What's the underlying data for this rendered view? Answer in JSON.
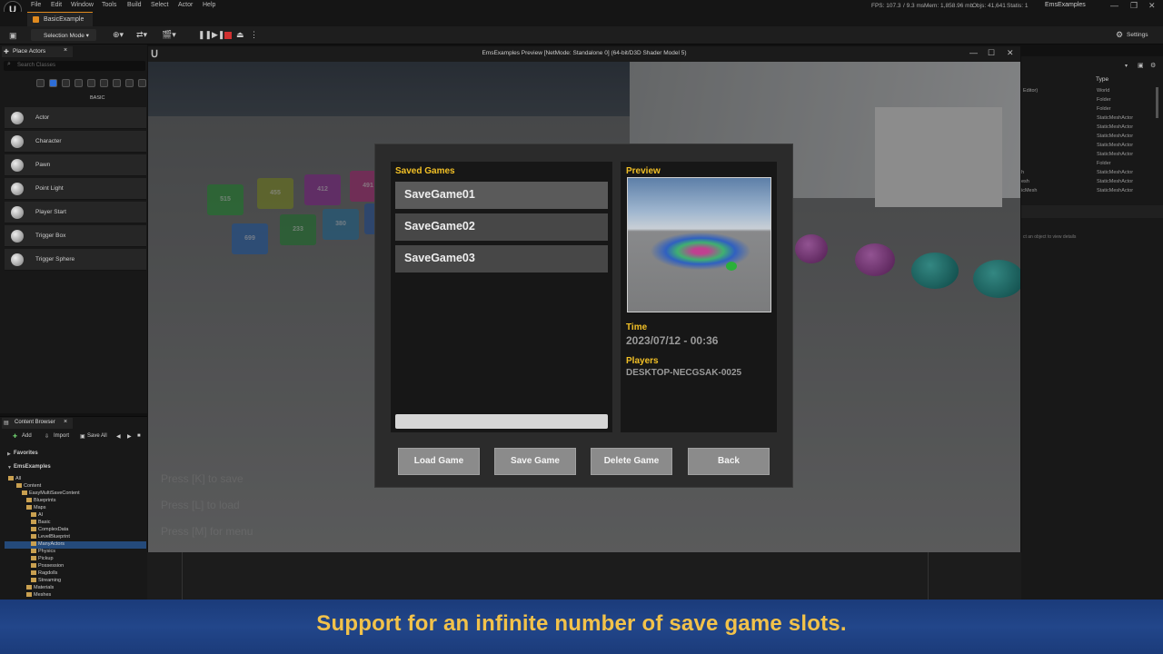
{
  "app": {
    "menu": [
      "File",
      "Edit",
      "Window",
      "Tools",
      "Build",
      "Select",
      "Actor",
      "Help"
    ],
    "level_tab": "BasicExample",
    "stats": {
      "fps": "FPS: 107.3",
      "ms": "/ 9.3 ms",
      "mem": "Mem: 1,858.96 mb",
      "objs": "Objs: 41,641",
      "statics": "Statis: 1"
    },
    "window_name": "EmsExamples"
  },
  "toolbar": {
    "selection_mode": "Selection Mode",
    "settings": "Settings"
  },
  "place_actors": {
    "tab": "Place Actors",
    "search_placeholder": "Search Classes",
    "category": "BASIC",
    "actors": [
      "Actor",
      "Character",
      "Pawn",
      "Point Light",
      "Player Start",
      "Trigger Box",
      "Trigger Sphere"
    ]
  },
  "content_browser": {
    "tab": "Content Browser",
    "add": "Add",
    "import": "Import",
    "save_all": "Save All",
    "favorites": "Favorites",
    "project": "EmsExamples",
    "tree": [
      "All",
      "Content",
      "EasyMultiSaveContent",
      "Blueprints",
      "Maps",
      "AI",
      "Basic",
      "ComplexData",
      "LevelBlueprint",
      "ManyActors",
      "Physics",
      "Pickup",
      "Possession",
      "Ragdolls",
      "Streaming",
      "Materials",
      "Meshes"
    ]
  },
  "outliner": {
    "type_header": "Type",
    "editor_suffix": "Editor)",
    "rows": [
      [
        "",
        "World"
      ],
      [
        "",
        "Folder"
      ],
      [
        "",
        "Folder"
      ],
      [
        "",
        "StaticMeshActor"
      ],
      [
        "",
        "StaticMeshActor"
      ],
      [
        "",
        "StaticMeshActor"
      ],
      [
        "",
        "StaticMeshActor"
      ],
      [
        "",
        "StaticMeshActor"
      ],
      [
        "",
        "StaticMeshActor"
      ],
      [
        "",
        "Folder"
      ],
      [
        "h",
        "StaticMeshActor"
      ],
      [
        "esh",
        "StaticMeshActor"
      ],
      [
        "icMesh",
        "StaticMeshActor"
      ]
    ],
    "details_hint": "ct an object to view details"
  },
  "preview_window": {
    "title": "EmsExamples Preview [NetMode: Standalone 0]  (64-bit/D3D Shader Model 5)"
  },
  "scene": {
    "cubes": [
      {
        "label": "515",
        "color": "#3aa84a"
      },
      {
        "label": "455",
        "color": "#9aa83a"
      },
      {
        "label": "412",
        "color": "#a03aa8"
      },
      {
        "label": "491",
        "color": "#c03a8a"
      },
      {
        "label": "699",
        "color": "#3a78c8"
      },
      {
        "label": "233",
        "color": "#3a9a4a"
      },
      {
        "label": "380",
        "color": "#3a88b8"
      },
      {
        "label": "",
        "color": "#3a6ab8"
      }
    ],
    "hints": [
      "Press [K] to save",
      "Press [L] to load",
      "Press [M] for menu"
    ]
  },
  "dialog": {
    "saved_games_title": "Saved Games",
    "slots": [
      "SaveGame01",
      "SaveGame02",
      "SaveGame03"
    ],
    "preview_title": "Preview",
    "time_label": "Time",
    "time_value": "2023/07/12 - 00:36",
    "players_label": "Players",
    "players_value": "DESKTOP-NECGSAK-0025",
    "buttons": [
      "Load Game",
      "Save Game",
      "Delete Game",
      "Back"
    ]
  },
  "banner": {
    "text": "Support for an infinite number of save game slots."
  },
  "colors": {
    "accent": "#f2c026",
    "banner_bg": "#22468a",
    "banner_text": "#f2c24a"
  }
}
